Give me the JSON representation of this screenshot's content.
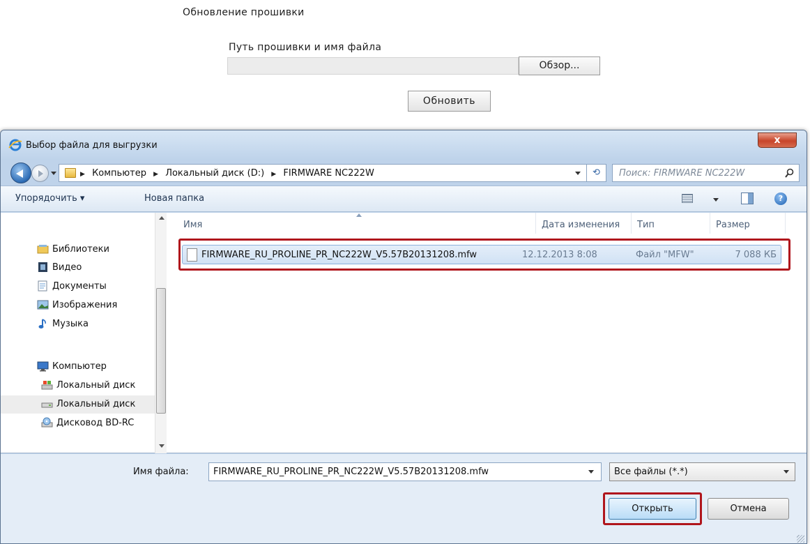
{
  "page": {
    "title": "Обновление прошивки",
    "path_label": "Путь прошивки и имя файла",
    "path_value": "",
    "browse_label": "Обзор...",
    "update_label": "Обновить"
  },
  "dialog": {
    "title": "Выбор файла для выгрузки",
    "close_label": "x",
    "breadcrumb": [
      "Компьютер",
      "Локальный диск (D:)",
      "FIRMWARE NC222W"
    ],
    "search_placeholder": "Поиск: FIRMWARE NC222W",
    "toolbar": {
      "organize": "Упорядочить ▾",
      "new_folder": "Новая папка",
      "help": "?"
    },
    "nav": [
      {
        "label": "Библиотеки",
        "icon": "libraries-icon"
      },
      {
        "label": "Видео",
        "icon": "video-icon"
      },
      {
        "label": "Документы",
        "icon": "documents-icon"
      },
      {
        "label": "Изображения",
        "icon": "images-icon"
      },
      {
        "label": "Музыка",
        "icon": "music-icon"
      },
      {
        "label": "Компьютер",
        "icon": "computer-icon"
      },
      {
        "label": "Локальный диск",
        "icon": "local-disk-icon"
      },
      {
        "label": "Локальный диск",
        "icon": "local-disk-icon"
      },
      {
        "label": "Дисковод BD-RC",
        "icon": "bd-drive-icon"
      }
    ],
    "columns": [
      "Имя",
      "Дата изменения",
      "Тип",
      "Размер"
    ],
    "files": [
      {
        "name": "FIRMWARE_RU_PROLINE_PR_NC222W_V5.57B20131208.mfw",
        "date": "12.12.2013 8:08",
        "type": "Файл \"MFW\"",
        "size": "7 088 КБ"
      }
    ],
    "filename_label": "Имя файла:",
    "filename_value": "FIRMWARE_RU_PROLINE_PR_NC222W_V5.57B20131208.mfw",
    "filetype_value": "Все файлы (*.*)",
    "open_label": "Открыть",
    "cancel_label": "Отмена"
  },
  "colors": {
    "highlight": "#b0151c",
    "dialog_frame": "#bfd3ea",
    "selection": "#d1e2f5"
  }
}
